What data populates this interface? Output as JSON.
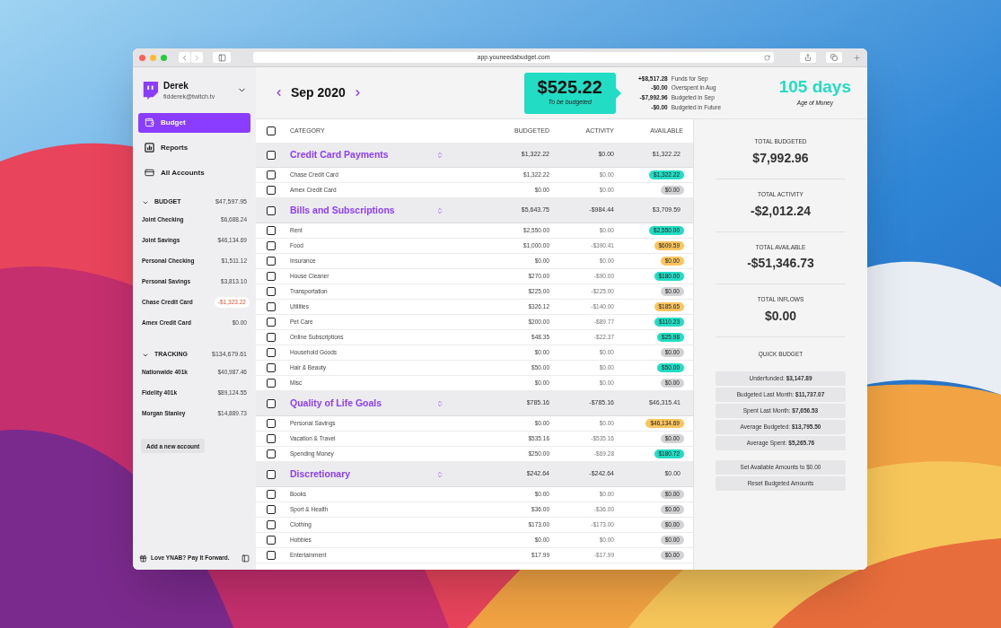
{
  "browser": {
    "url": "app.youneedabudget.com"
  },
  "user": {
    "name": "Derek",
    "email": "fidderek@twitch.tv"
  },
  "nav": [
    {
      "label": "Budget",
      "kind": "budget",
      "selected": true
    },
    {
      "label": "Reports",
      "kind": "reports",
      "selected": false
    },
    {
      "label": "All Accounts",
      "kind": "accounts",
      "selected": false
    }
  ],
  "account_groups": [
    {
      "label": "BUDGET",
      "total": "$47,597.95",
      "expanded": true,
      "accounts": [
        {
          "name": "Joint Checking",
          "balance": "$6,688.24",
          "negative": false
        },
        {
          "name": "Joint Savings",
          "balance": "$46,134.69",
          "negative": false
        },
        {
          "name": "Personal Checking",
          "balance": "$1,511.12",
          "negative": false
        },
        {
          "name": "Personal Savings",
          "balance": "$3,813.10",
          "negative": false
        },
        {
          "name": "Chase Credit Card",
          "balance": "-$1,323.22",
          "negative": true
        },
        {
          "name": "Amex Credit Card",
          "balance": "$0.00",
          "negative": false
        }
      ]
    },
    {
      "label": "TRACKING",
      "total": "$134,679.61",
      "expanded": true,
      "accounts": [
        {
          "name": "Nationwide 401k",
          "balance": "$40,987.46",
          "negative": false
        },
        {
          "name": "Fidelity 401k",
          "balance": "$89,124.55",
          "negative": false
        },
        {
          "name": "Morgan Stanley",
          "balance": "$14,889.73",
          "negative": false
        }
      ]
    }
  ],
  "add_account": "Add a new account",
  "footer": {
    "label": "Love YNAB? Pay It Forward."
  },
  "header": {
    "month": "Sep 2020",
    "to_be_budgeted": {
      "amount": "$525.22",
      "label": "To be budgeted"
    },
    "breakdown": [
      {
        "amount": "+$8,517.28",
        "label": "Funds for Sep"
      },
      {
        "amount": "-$0.00",
        "label": "Overspent in Aug"
      },
      {
        "amount": "-$7,992.96",
        "label": "Budgeted in Sep"
      },
      {
        "amount": "-$0.00",
        "label": "Budgeted in Future"
      }
    ],
    "age_of_money": {
      "value": "105 days",
      "label": "Age of Money"
    }
  },
  "table": {
    "select_all": {
      "checked": false
    },
    "columns": [
      "CATEGORY",
      "BUDGETED",
      "ACTIVITY",
      "AVAILABLE"
    ],
    "groups": [
      {
        "name": "Credit Card Payments",
        "checked": false,
        "budgeted": "$1,322.22",
        "activity": "$0.00",
        "available": "$1,322.22",
        "categories": [
          {
            "name": "Chase Credit Card",
            "checked": false,
            "budgeted": "$1,322.22",
            "activity": "$0.00",
            "available": "$1,322.22",
            "color": "#22dcc4"
          },
          {
            "name": "Amex Credit Card",
            "checked": false,
            "budgeted": "$0.00",
            "activity": "$0.00",
            "available": "$0.00",
            "color": "#d2d2d5"
          }
        ]
      },
      {
        "name": "Bills and Subscriptions",
        "checked": false,
        "budgeted": "$5,643.75",
        "activity": "-$984.44",
        "available": "$3,709.59",
        "categories": [
          {
            "name": "Rent",
            "checked": false,
            "budgeted": "$2,550.00",
            "activity": "$0.00",
            "available": "$2,550.00",
            "color": "#22dcc4"
          },
          {
            "name": "Food",
            "checked": false,
            "budgeted": "$1,000.00",
            "activity": "-$390.41",
            "available": "$609.59",
            "color": "#fbc45c"
          },
          {
            "name": "Insurance",
            "checked": false,
            "budgeted": "$0.00",
            "activity": "$0.00",
            "available": "$0.00",
            "color": "#fbc45c"
          },
          {
            "name": "House Cleaner",
            "checked": false,
            "budgeted": "$270.00",
            "activity": "-$90.00",
            "available": "$180.00",
            "color": "#22dcc4"
          },
          {
            "name": "Transportation",
            "checked": false,
            "budgeted": "$225.00",
            "activity": "-$225.00",
            "available": "$0.00",
            "color": "#d2d2d5"
          },
          {
            "name": "Utilities",
            "checked": false,
            "budgeted": "$326.12",
            "activity": "-$140.00",
            "available": "$185.65",
            "color": "#fbc45c"
          },
          {
            "name": "Pet Care",
            "checked": false,
            "budgeted": "$200.00",
            "activity": "-$89.77",
            "available": "$110.23",
            "color": "#22dcc4"
          },
          {
            "name": "Online Subscriptions",
            "checked": false,
            "budgeted": "$48.35",
            "activity": "-$22.37",
            "available": "$25.98",
            "color": "#22dcc4"
          },
          {
            "name": "Household Goods",
            "checked": false,
            "budgeted": "$0.00",
            "activity": "$0.00",
            "available": "$0.00",
            "color": "#d2d2d5"
          },
          {
            "name": "Hair & Beauty",
            "checked": false,
            "budgeted": "$50.00",
            "activity": "$0.00",
            "available": "$50.00",
            "color": "#22dcc4"
          },
          {
            "name": "Misc",
            "checked": false,
            "budgeted": "$0.00",
            "activity": "$0.00",
            "available": "$0.00",
            "color": "#d2d2d5"
          }
        ]
      },
      {
        "name": "Quality of Life Goals",
        "checked": false,
        "budgeted": "$785.16",
        "activity": "-$785.16",
        "available": "$46,315.41",
        "categories": [
          {
            "name": "Personal Savings",
            "checked": false,
            "budgeted": "$0.00",
            "activity": "$0.00",
            "available": "$46,134.69",
            "color": "#fbc45c"
          },
          {
            "name": "Vacation & Travel",
            "checked": false,
            "budgeted": "$535.16",
            "activity": "-$535.16",
            "available": "$0.00",
            "color": "#d2d2d5"
          },
          {
            "name": "Spending Money",
            "checked": false,
            "budgeted": "$250.00",
            "activity": "-$69.28",
            "available": "$180.72",
            "color": "#22dcc4"
          }
        ]
      },
      {
        "name": "Discretionary",
        "checked": false,
        "budgeted": "$242.64",
        "activity": "-$242.64",
        "available": "$0.00",
        "categories": [
          {
            "name": "Books",
            "checked": false,
            "budgeted": "$0.00",
            "activity": "$0.00",
            "available": "$0.00",
            "color": "#d2d2d5"
          },
          {
            "name": "Sport & Health",
            "checked": false,
            "budgeted": "$36.00",
            "activity": "-$36.00",
            "available": "$0.00",
            "color": "#d2d2d5"
          },
          {
            "name": "Clothing",
            "checked": false,
            "budgeted": "$173.00",
            "activity": "-$173.00",
            "available": "$0.00",
            "color": "#d2d2d5"
          },
          {
            "name": "Hobbies",
            "checked": false,
            "budgeted": "$0.00",
            "activity": "$0.00",
            "available": "$0.00",
            "color": "#d2d2d5"
          },
          {
            "name": "Entertainment",
            "checked": false,
            "budgeted": "$17.99",
            "activity": "-$17.99",
            "available": "$0.00",
            "color": "#d2d2d5"
          }
        ]
      }
    ]
  },
  "inspector": {
    "totals": [
      {
        "label": "TOTAL BUDGETED",
        "value": "$7,992.96"
      },
      {
        "label": "TOTAL ACTIVITY",
        "value": "-$2,012.24"
      },
      {
        "label": "TOTAL AVAILABLE",
        "value": "-$51,346.73"
      },
      {
        "label": "TOTAL INFLOWS",
        "value": "$0.00"
      }
    ],
    "quick_budget": {
      "title": "QUICK BUDGET",
      "options": [
        "Underfunded: **$3,147.89**",
        "Budgeted Last Month: **$11,737.07**",
        "Spent Last Month: **$7,656.53**",
        "Average Budgeted: **$13,795.50**",
        "Average Spent: **$5,265.76**"
      ]
    },
    "actions": [
      "Set Available Amounts to $0.00",
      "Reset Budgeted Amounts"
    ]
  }
}
